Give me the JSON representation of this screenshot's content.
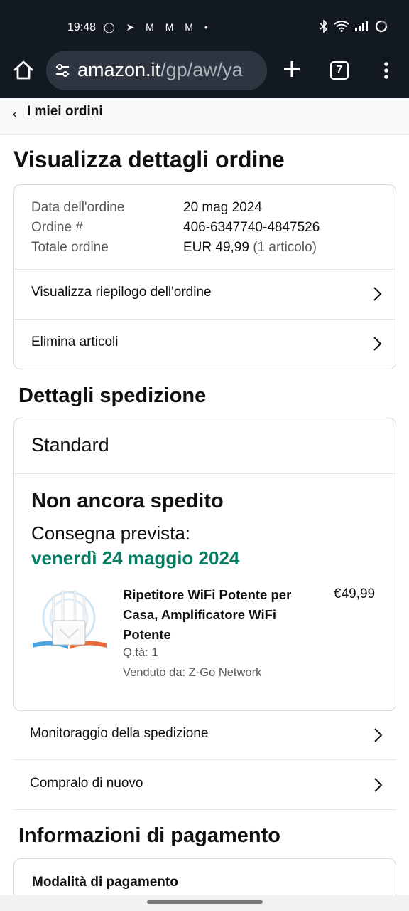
{
  "status_bar": {
    "time": "19:48",
    "notifications": "◯ ➤ M M M •"
  },
  "browser": {
    "url_domain": "amazon.it",
    "url_path": "/gp/aw/ya",
    "tab_count": "7"
  },
  "breadcrumb": {
    "label": "I miei ordini"
  },
  "page": {
    "title": "Visualizza dettagli ordine"
  },
  "order_summary": {
    "date_label": "Data dell'ordine",
    "date_value": "20 mag 2024",
    "order_label": "Ordine #",
    "order_value": "406-6347740-4847526",
    "total_label": "Totale ordine",
    "total_value": "EUR 49,99",
    "total_items": "(1 articolo)",
    "link_summary": "Visualizza riepilogo dell'ordine",
    "link_delete": "Elimina articoli"
  },
  "shipping": {
    "section_title": "Dettagli spedizione",
    "method": "Standard",
    "status": "Non ancora spedito",
    "eta_label": "Consegna prevista:",
    "eta_date": "venerdì 24 maggio 2024",
    "product": {
      "title": "Ripetitore WiFi Potente per Casa, Amplificatore WiFi Potente",
      "price": "€49,99",
      "qty": "Q.tà: 1",
      "seller": "Venduto da: Z-Go Network"
    },
    "link_track": "Monitoraggio della spedizione",
    "link_rebuy": "Compralo di nuovo"
  },
  "payment": {
    "section_title": "Informazioni di pagamento",
    "method_title": "Modalità di pagamento"
  },
  "colors": {
    "header_bg": "#131921",
    "eta_green": "#067d62"
  }
}
